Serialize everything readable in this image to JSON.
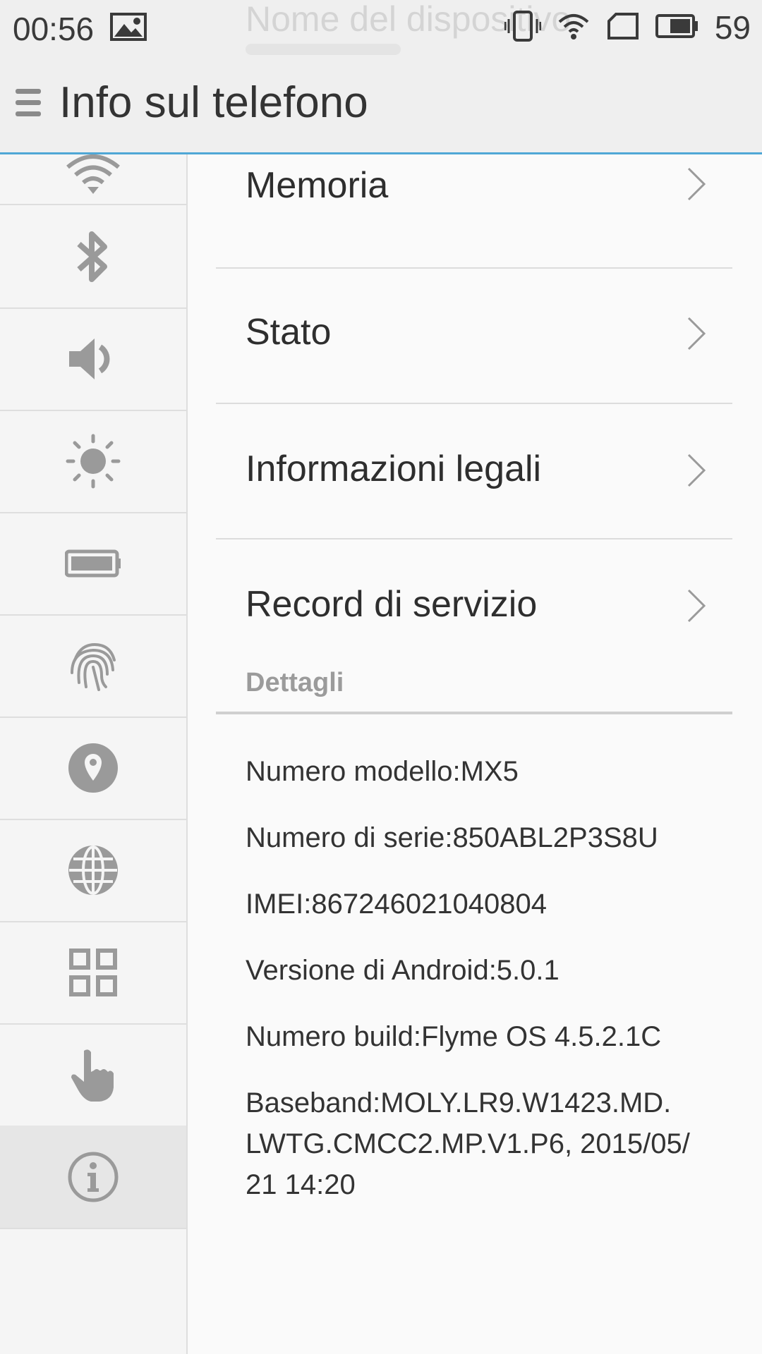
{
  "status_bar": {
    "time": "00:56",
    "battery_level": "59",
    "ghost_title": "Nome del dispositivo"
  },
  "app_bar": {
    "title": "Info sul telefono"
  },
  "sidebar": {
    "items": [
      {
        "icon": "wifi-icon"
      },
      {
        "icon": "bluetooth-icon"
      },
      {
        "icon": "volume-icon"
      },
      {
        "icon": "brightness-icon"
      },
      {
        "icon": "battery-icon"
      },
      {
        "icon": "fingerprint-icon"
      },
      {
        "icon": "location-icon"
      },
      {
        "icon": "globe-icon"
      },
      {
        "icon": "apps-grid-icon"
      },
      {
        "icon": "hand-pointer-icon"
      },
      {
        "icon": "info-icon",
        "active": true
      }
    ]
  },
  "menu": [
    {
      "label": "Memoria"
    },
    {
      "label": "Stato"
    },
    {
      "label": "Informazioni legali"
    },
    {
      "label": "Record di servizio"
    }
  ],
  "details": {
    "header": "Dettagli",
    "lines": [
      "Numero modello:MX5",
      "Numero di serie:850ABL2P3S8U",
      "IMEI:867246021040804",
      "Versione di Android:5.0.1",
      "Numero build:Flyme OS 4.5.2.1C",
      "Baseband:MOLY.LR9.W1423.MD. LWTG.CMCC2.MP.V1.P6, 2015/05/ 21 14:20"
    ]
  },
  "colors": {
    "accent": "#4fa7d6",
    "icon_gray": "#9a9a9a"
  }
}
